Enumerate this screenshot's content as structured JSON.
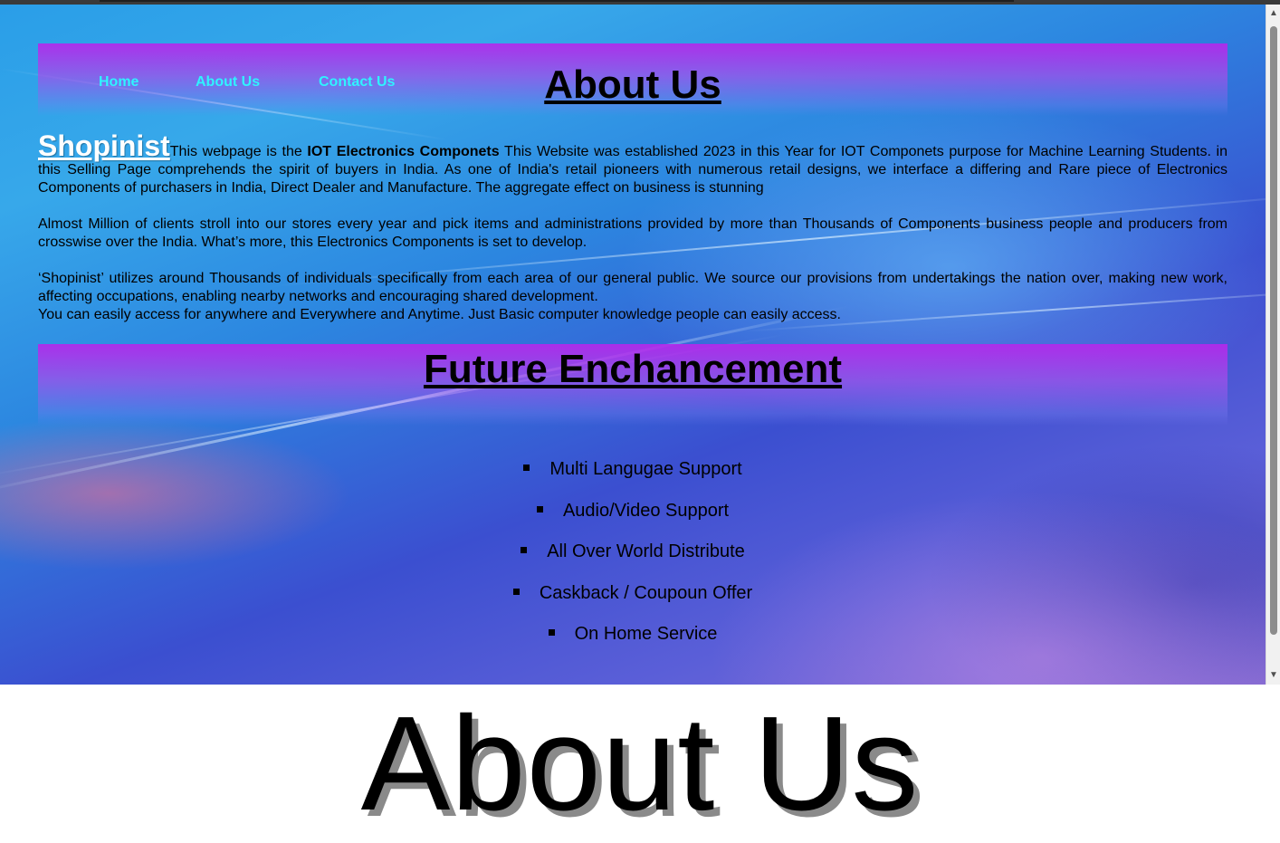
{
  "nav": {
    "home": "Home",
    "about": "About Us",
    "contact": "Contact Us"
  },
  "header": {
    "title": "About Us"
  },
  "about": {
    "brand": "Shopinist",
    "p1_intro": "This webpage is the ",
    "p1_strong": "IOT Electronics Componets",
    "p1_rest": " This Website was established 2023 in this Year for IOT Componets purpose for Machine Learning Students. in this Selling Page comprehends the spirit of buyers in India. As one of India's retail pioneers with numerous retail designs, we interface a differing and Rare piece of Electronics Components of purchasers in India, Direct Dealer and Manufacture. The aggregate effect on business is stunning",
    "p2": "Almost Million of clients stroll into our stores every year and pick items and administrations provided by more than Thousands of Components business people and producers from crosswise over the India. What’s more, this Electronics Components is set to develop.",
    "p3": "‘Shopinist’ utilizes around Thousands of individuals specifically from each area of our general public. We source our provisions from undertakings the nation over, making new work, affecting occupations, enabling nearby networks and encouraging shared development.",
    "p4": "You can easily access for anywhere and Everywhere and Anytime. Just Basic computer knowledge people can easily access."
  },
  "future": {
    "title": "Future Enchancement",
    "items": [
      "Multi Langugae Support",
      "Audio/Video Support",
      "All Over World Distribute",
      "Caskback / Coupoun Offer",
      "On Home Service"
    ]
  },
  "below": {
    "title": "About Us"
  },
  "colors": {
    "nav_link": "#2ff3ff",
    "band_purple": "#b428eb",
    "bg_blue": "#2a9ee8"
  }
}
